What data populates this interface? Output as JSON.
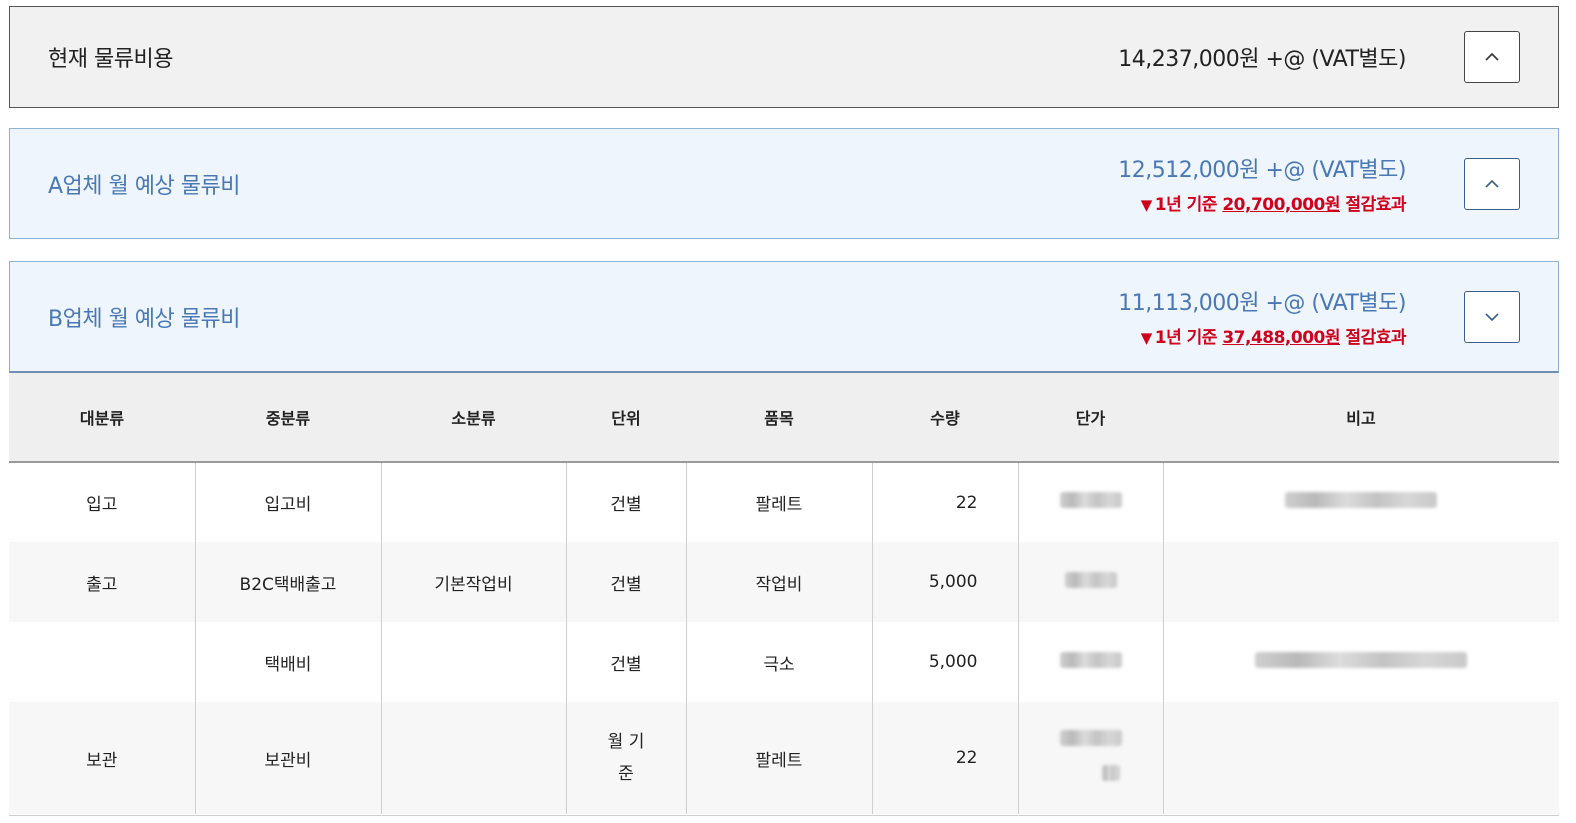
{
  "current": {
    "title": "현재 물류비용",
    "price": "14,237,000원 +@ (VAT별도)"
  },
  "vendor_a": {
    "title": "A업체 월 예상 물류비",
    "price": "12,512,000원 +@ (VAT별도)",
    "saving_prefix": "1년 기준 ",
    "saving_amount": "20,700,000원",
    "saving_suffix": " 절감효과"
  },
  "vendor_b": {
    "title": "B업체 월 예상 물류비",
    "price": "11,113,000원 +@ (VAT별도)",
    "saving_prefix": "1년 기준 ",
    "saving_amount": "37,488,000원",
    "saving_suffix": " 절감효과"
  },
  "icons": {
    "down_triangle": "▼",
    "collapse": "chevron-up-icon",
    "expand": "chevron-down-icon"
  },
  "colors": {
    "accent_blue": "#4a78b4",
    "saving_red": "#d0021b",
    "panel_blue_bg": "#eef5fd"
  },
  "table": {
    "headers": [
      "대분류",
      "중분류",
      "소분류",
      "단위",
      "품목",
      "수량",
      "단가",
      "비고"
    ],
    "rows": [
      {
        "major": "입고",
        "middle": "입고비",
        "minor": "",
        "unit": "건별",
        "item": "팔레트",
        "qty": "22"
      },
      {
        "major": "출고",
        "middle": "B2C택배출고",
        "minor": "기본작업비",
        "unit": "건별",
        "item": "작업비",
        "qty": "5,000"
      },
      {
        "major": "",
        "middle": "택배비",
        "minor": "",
        "unit": "건별",
        "item": "극소",
        "qty": "5,000"
      },
      {
        "major": "보관",
        "middle": "보관비",
        "minor": "",
        "unit_line1": "월 기",
        "unit_line2": "준",
        "item": "팔레트",
        "qty": "22"
      }
    ]
  }
}
